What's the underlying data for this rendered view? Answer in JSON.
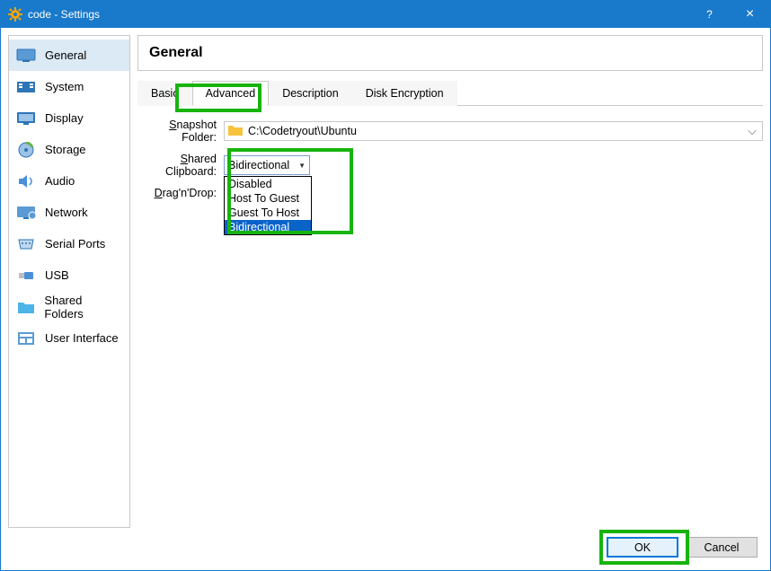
{
  "titlebar": {
    "title": "code - Settings",
    "help": "?",
    "close": "×"
  },
  "sidebar": {
    "items": [
      {
        "label": "General"
      },
      {
        "label": "System"
      },
      {
        "label": "Display"
      },
      {
        "label": "Storage"
      },
      {
        "label": "Audio"
      },
      {
        "label": "Network"
      },
      {
        "label": "Serial Ports"
      },
      {
        "label": "USB"
      },
      {
        "label": "Shared Folders"
      },
      {
        "label": "User Interface"
      }
    ]
  },
  "content": {
    "heading": "General",
    "tabs": {
      "t0": "Basic",
      "t1": "Advanced",
      "t2": "Description",
      "t3": "Disk Encryption"
    },
    "snapshot": {
      "label": "napshot Folder:",
      "prefix": "S",
      "value": "C:\\Codetryout\\Ubuntu"
    },
    "clipboard": {
      "label": "hared Clipboard:",
      "prefix": "S",
      "value": "Bidirectional",
      "options": {
        "o0": "Disabled",
        "o1": "Host To Guest",
        "o2": "Guest To Host",
        "o3": "Bidirectional"
      }
    },
    "dragdrop": {
      "label": "rag'n'Drop:",
      "prefix": "D"
    }
  },
  "footer": {
    "ok": "OK",
    "cancel": "Cancel"
  }
}
